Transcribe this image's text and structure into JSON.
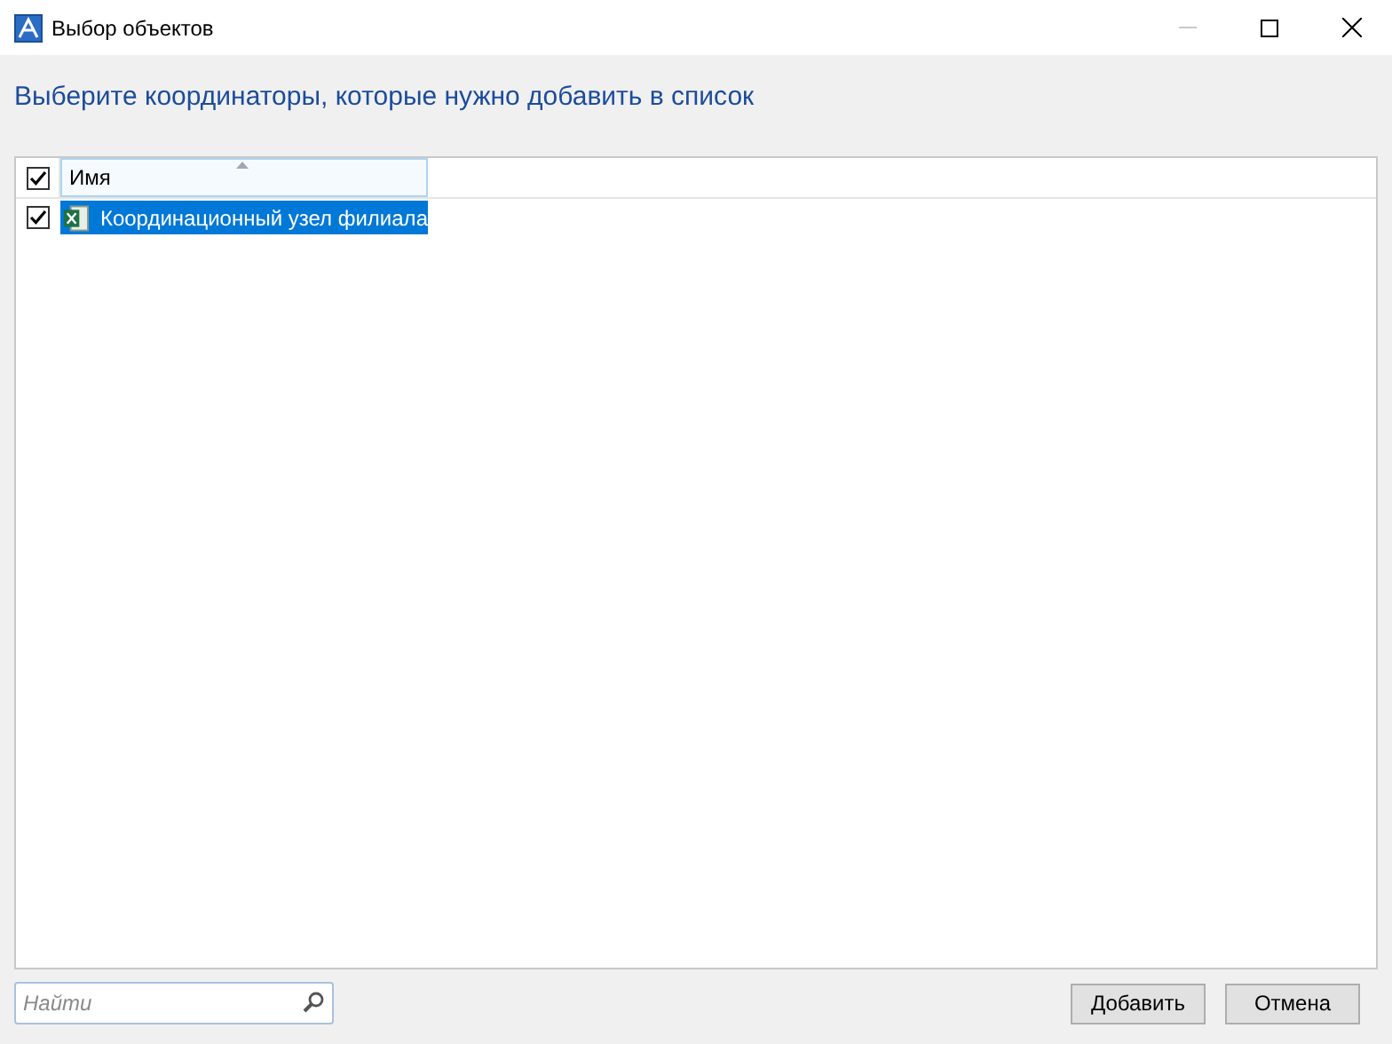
{
  "window": {
    "title": "Выбор объектов",
    "minimize_disabled": true
  },
  "heading": "Выберите координаторы, которые нужно добавить в список",
  "table": {
    "header_checked": true,
    "columns": [
      {
        "label": "Имя",
        "sorted": true
      }
    ],
    "rows": [
      {
        "name": "Координационный узел филиала",
        "checked": true,
        "selected": true
      }
    ]
  },
  "search": {
    "placeholder": "Найти"
  },
  "buttons": [
    "Добавить",
    "Отмена"
  ]
}
